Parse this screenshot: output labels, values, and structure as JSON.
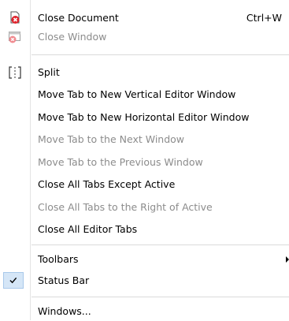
{
  "menu": {
    "items": [
      {
        "label": "Close Document",
        "shortcut": "Ctrl+W",
        "icon": "close-document-icon"
      },
      {
        "label": "Close Window",
        "icon": "close-window-icon"
      },
      {
        "label": "Split",
        "icon": "split-icon"
      },
      {
        "label": "Move Tab to New Vertical Editor Window"
      },
      {
        "label": "Move Tab to New Horizontal Editor Window"
      },
      {
        "label": "Move Tab to the Next Window"
      },
      {
        "label": "Move Tab to the Previous Window"
      },
      {
        "label": "Close All Tabs Except Active"
      },
      {
        "label": "Close All Tabs to the Right of Active"
      },
      {
        "label": "Close All Editor Tabs"
      },
      {
        "label": "Toolbars",
        "submenu": true
      },
      {
        "label": "Status Bar",
        "checked": true
      },
      {
        "label": "Windows..."
      }
    ],
    "colors": {
      "disabled_text": "#8c8c8c",
      "close_icon_red": "#e0232c",
      "check_highlight": "#d5e6f7"
    }
  }
}
